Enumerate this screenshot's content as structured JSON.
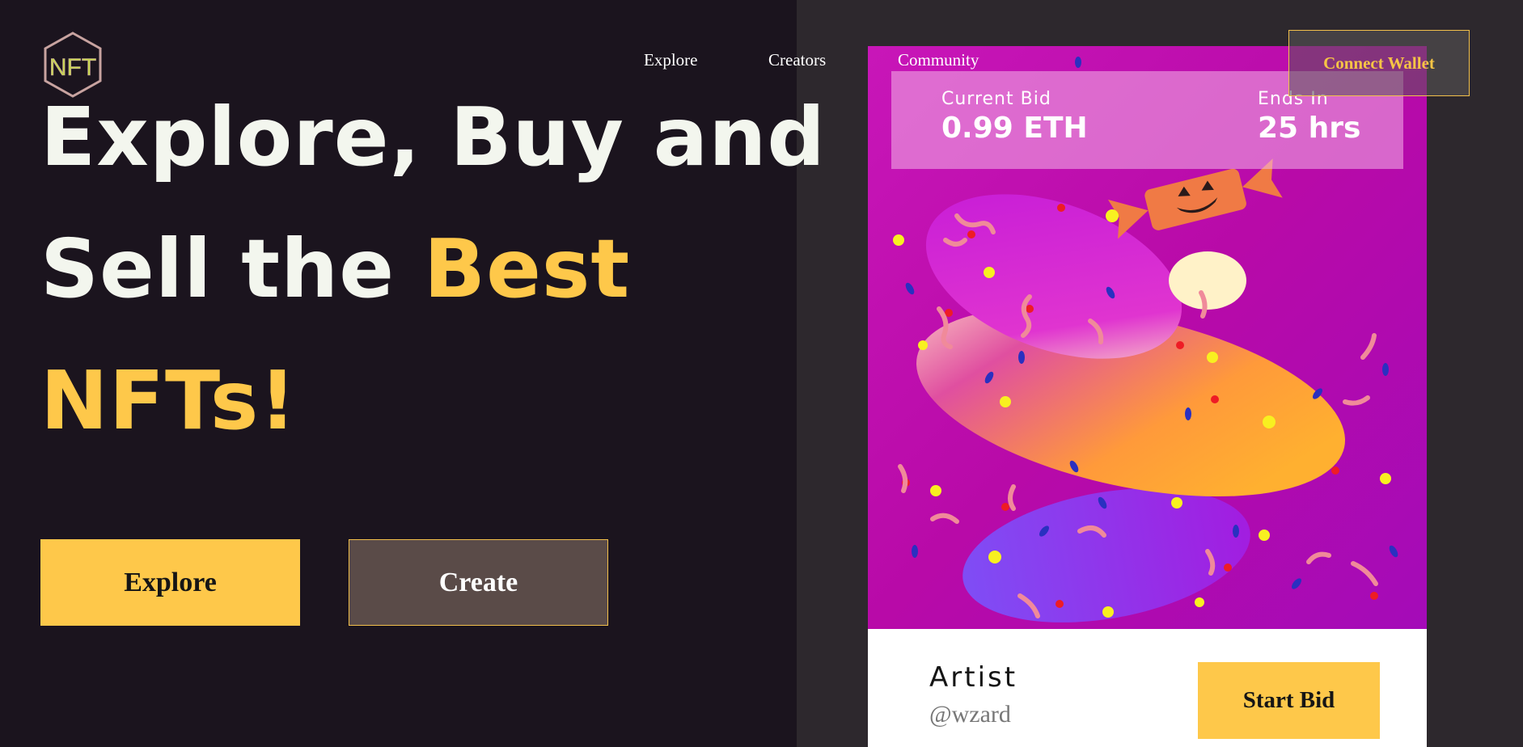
{
  "brand": {
    "logo_text": "NFT"
  },
  "nav": {
    "explore": "Explore",
    "creators": "Creators",
    "community": "Community",
    "connect_wallet": "Connect Wallet"
  },
  "hero": {
    "line1": "Explore, Buy and",
    "line2_plain": "Sell the ",
    "line2_accent": "Best",
    "line3": "NFTs!"
  },
  "actions": {
    "explore": "Explore",
    "create": "Create"
  },
  "card": {
    "current_bid_label": "Current Bid",
    "current_bid_value": "0.99 ETH",
    "ends_in_label": "Ends In",
    "ends_in_value": "25 hrs",
    "artist_label": "Artist",
    "artist_handle": "@wzard",
    "start_bid": "Start Bid"
  },
  "colors": {
    "background": "#1b141e",
    "panel": "#2d282d",
    "accent": "#fec84a",
    "hero_text": "#f3f6ee"
  }
}
